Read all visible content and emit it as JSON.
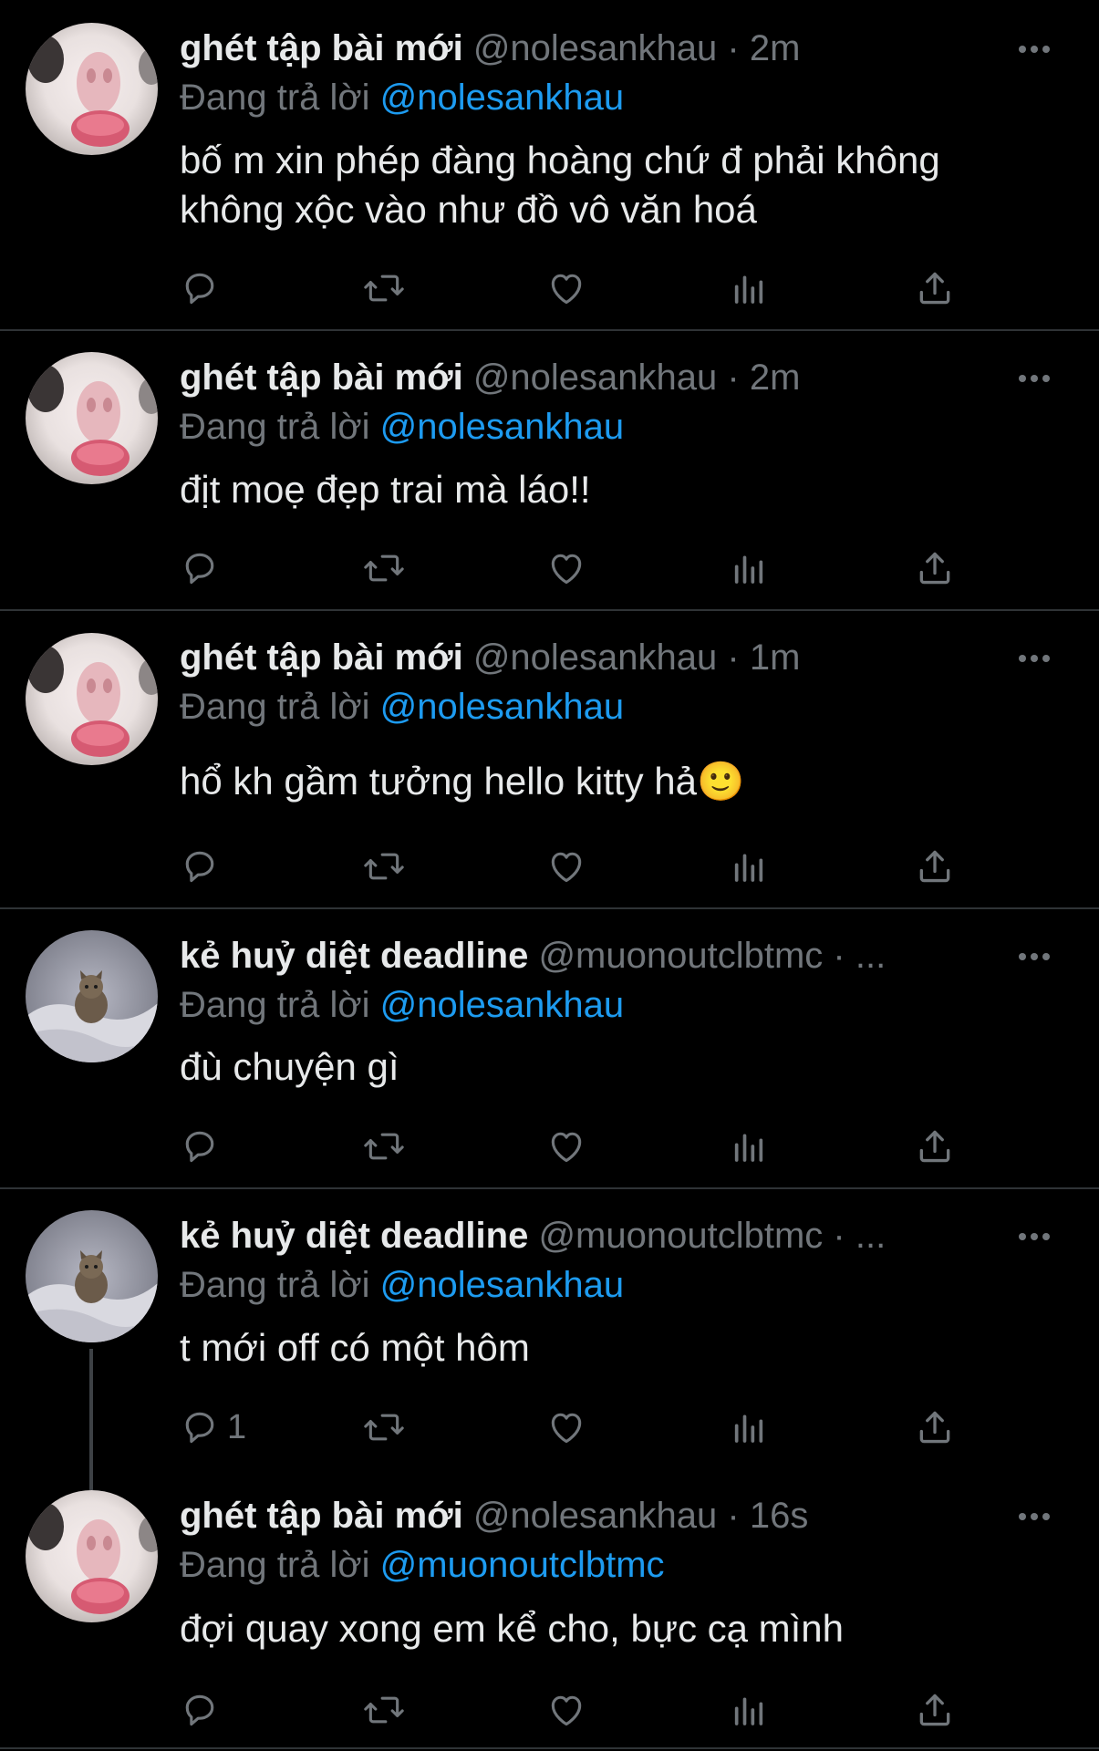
{
  "colors": {
    "background": "#000000",
    "text": "#e7e9ea",
    "muted": "#71767b",
    "accent": "#1d9bf0",
    "divider": "#2f3336"
  },
  "icons": {
    "more": "more-horizontal-icon",
    "reply": "reply-icon",
    "retweet": "retweet-icon",
    "like": "heart-icon",
    "views": "views-icon",
    "share": "share-icon"
  },
  "tweets": [
    {
      "name": "ghét tập bài mới",
      "handle": "@nolesankhau",
      "dot": "·",
      "time": "2m",
      "reply_prefix": "Đang trả lời",
      "reply_to": "@nolesankhau",
      "text": "bố m xin phép đàng hoàng chứ đ phải không\nkhông xộc vào như đồ vô văn hoá",
      "reply_count": ""
    },
    {
      "name": "ghét tập bài mới",
      "handle": "@nolesankhau",
      "dot": "·",
      "time": "2m",
      "reply_prefix": "Đang trả lời",
      "reply_to": "@nolesankhau",
      "text": "địt moẹ đẹp trai mà láo!!",
      "reply_count": ""
    },
    {
      "name": "ghét tập bài mới",
      "handle": "@nolesankhau",
      "dot": "·",
      "time": "1m",
      "reply_prefix": "Đang trả lời",
      "reply_to": "@nolesankhau",
      "text": "hổ kh gầm tưởng hello kitty hả🙂",
      "reply_count": ""
    },
    {
      "name": "kẻ huỷ diệt deadline",
      "handle": "@muonoutclbtmc",
      "dot": "·",
      "time": "...",
      "reply_prefix": "Đang trả lời",
      "reply_to": "@nolesankhau",
      "text": "đù chuyện gì",
      "reply_count": ""
    },
    {
      "name": "kẻ huỷ diệt deadline",
      "handle": "@muonoutclbtmc",
      "dot": "·",
      "time": "...",
      "reply_prefix": "Đang trả lời",
      "reply_to": "@nolesankhau",
      "text": "t mới off có một hôm",
      "reply_count": "1"
    },
    {
      "name": "ghét tập bài mới",
      "handle": "@nolesankhau",
      "dot": "·",
      "time": "16s",
      "reply_prefix": "Đang trả lời",
      "reply_to": "@muonoutclbtmc",
      "text": "đợi quay xong em kể cho, bực cạ mình",
      "reply_count": ""
    }
  ]
}
